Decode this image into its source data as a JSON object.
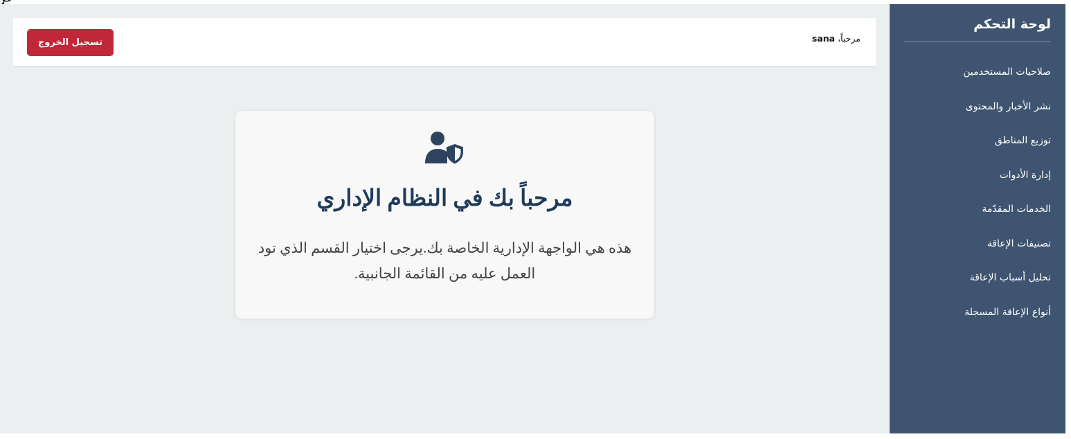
{
  "top_fragment": "g",
  "header": {
    "greeting_prefix": "مرحباً،",
    "username": "sana",
    "logout_label": "تسجيل الخروج"
  },
  "card": {
    "icon": "user-shield-icon",
    "title": "مرحباً بك في النظام الإداري",
    "text": "هذه هي الواجهة الإدارية الخاصة بك.يرجى اختيار القسم الذي تود العمل عليه من القائمة الجانبية."
  },
  "sidebar": {
    "title": "لوحة التحكم",
    "items": [
      {
        "label": "صلاحيات المستخدمين"
      },
      {
        "label": "نشر الأخبار والمحتوى"
      },
      {
        "label": "توزيع المناطق"
      },
      {
        "label": "إدارة الأدوات"
      },
      {
        "label": "الخدمات المقدّمة"
      },
      {
        "label": "تصنيفات الإعاقة"
      },
      {
        "label": "تحليل أسباب الإعاقة"
      },
      {
        "label": "أنواع الإعاقة المسجلة"
      }
    ]
  },
  "colors": {
    "sidebar_bg": "#3e5470",
    "main_bg": "#eceff0",
    "logout_button": "#c0283a",
    "title_color": "#1f3b5a",
    "icon_color": "#2e445e"
  }
}
